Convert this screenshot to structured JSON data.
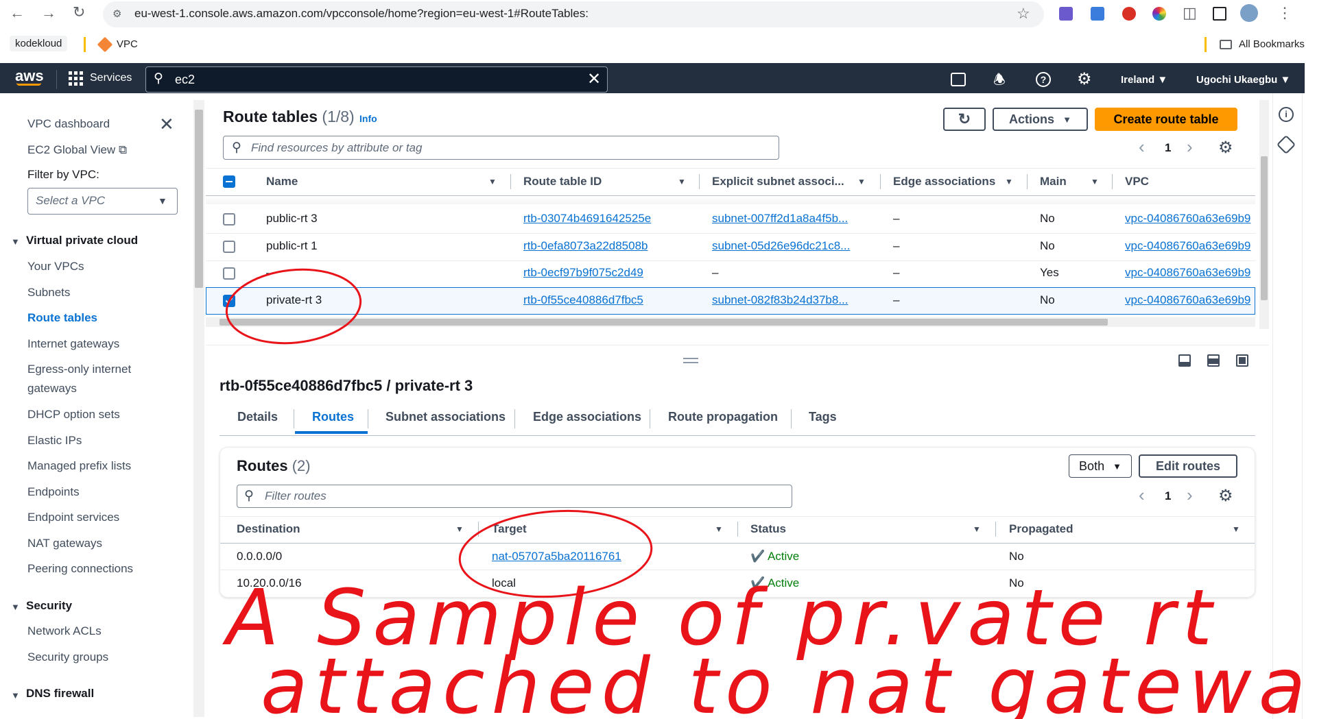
{
  "browser": {
    "url": "eu-west-1.console.aws.amazon.com/vpcconsole/home?region=eu-west-1#RouteTables:",
    "bookmarks": [
      "kodekloud",
      "VPC"
    ],
    "all_bookmarks": "All Bookmarks"
  },
  "topnav": {
    "logo": "aws",
    "services": "Services",
    "search_value": "ec2",
    "region": "Ireland",
    "user": "Ugochi Ukaegbu"
  },
  "sidebar": {
    "dashboard": "VPC dashboard",
    "global_view": "EC2 Global View",
    "filter_label": "Filter by VPC:",
    "filter_placeholder": "Select a VPC",
    "section_vpc": "Virtual private cloud",
    "items": [
      "Your VPCs",
      "Subnets",
      "Route tables",
      "Internet gateways",
      "Egress-only internet",
      "gateways",
      "DHCP option sets",
      "Elastic IPs",
      "Managed prefix lists",
      "Endpoints",
      "Endpoint services",
      "NAT gateways",
      "Peering connections"
    ],
    "section_security": "Security",
    "security_items": [
      "Network ACLs",
      "Security groups"
    ],
    "section_dns": "DNS firewall"
  },
  "route_tables": {
    "title": "Route tables",
    "count": "(1/8)",
    "info": "Info",
    "actions": "Actions",
    "create": "Create route table",
    "search_placeholder": "Find resources by attribute or tag",
    "page": "1",
    "columns": [
      "Name",
      "Route table ID",
      "Explicit subnet associ...",
      "Edge associations",
      "Main",
      "VPC"
    ],
    "rows": [
      {
        "name": "public-rt 3",
        "id": "rtb-03074b4691642525e",
        "subnet": "subnet-007ff2d1a8a4f5b...",
        "edge": "–",
        "main": "No",
        "vpc": "vpc-04086760a63e69b9",
        "selected": false
      },
      {
        "name": "public-rt 1",
        "id": "rtb-0efa8073a22d8508b",
        "subnet": "subnet-05d26e96dc21c8...",
        "edge": "–",
        "main": "No",
        "vpc": "vpc-04086760a63e69b9",
        "selected": false
      },
      {
        "name": "–",
        "id": "rtb-0ecf97b9f075c2d49",
        "subnet": "–",
        "edge": "–",
        "main": "Yes",
        "vpc": "vpc-04086760a63e69b9",
        "selected": false
      },
      {
        "name": "private-rt 3",
        "id": "rtb-0f55ce40886d7fbc5",
        "subnet": "subnet-082f83b24d37b8...",
        "edge": "–",
        "main": "No",
        "vpc": "vpc-04086760a63e69b9",
        "selected": true
      }
    ]
  },
  "detail": {
    "heading": "rtb-0f55ce40886d7fbc5 / private-rt 3",
    "tabs": [
      "Details",
      "Routes",
      "Subnet associations",
      "Edge associations",
      "Route propagation",
      "Tags"
    ],
    "active_tab": "Routes",
    "routes_title": "Routes",
    "routes_count": "(2)",
    "both": "Both",
    "edit_routes": "Edit routes",
    "filter_placeholder": "Filter routes",
    "page": "1",
    "columns": [
      "Destination",
      "Target",
      "Status",
      "Propagated"
    ],
    "routes": [
      {
        "destination": "0.0.0.0/0",
        "target": "nat-05707a5ba20116761",
        "status": "Active",
        "propagated": "No"
      },
      {
        "destination": "10.20.0.0/16",
        "target": "local",
        "status": "Active",
        "propagated": "No"
      }
    ]
  },
  "annotation": {
    "line1": "A Sample of pr.vate rt",
    "line2": "attached to nat gateway",
    "color": "#e8141a"
  },
  "colors": {
    "nav": "#232f3e",
    "primary": "#ff9900",
    "link": "#0972d3",
    "active_status": "#037f0c"
  }
}
